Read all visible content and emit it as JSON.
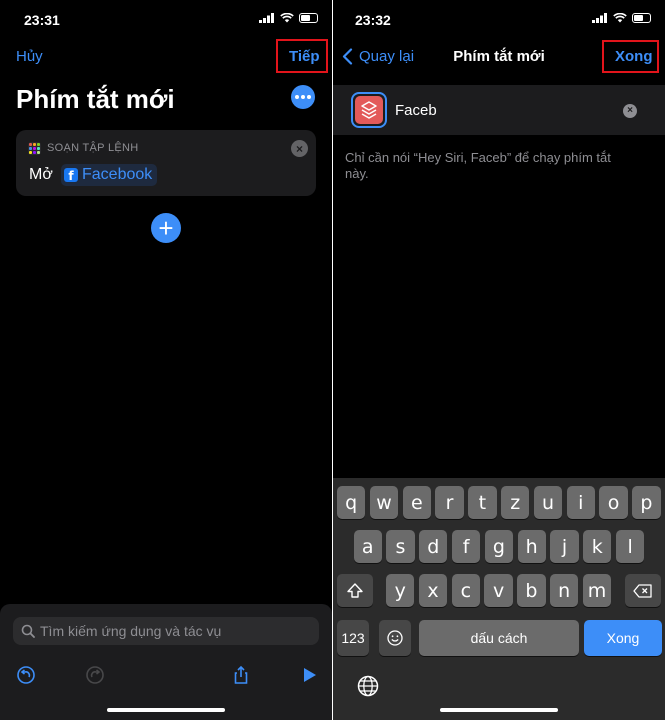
{
  "left": {
    "status": {
      "time": "23:31"
    },
    "nav": {
      "cancel": "Hủy",
      "next": "Tiếp"
    },
    "title": "Phím tắt mới",
    "action_card": {
      "header": "SOẠN TẬP LỆNH",
      "verb": "Mở",
      "app": "Facebook"
    },
    "search": {
      "placeholder": "Tìm kiếm ứng dụng và tác vụ"
    },
    "icons": [
      "undo-icon",
      "redo-icon",
      "share-icon",
      "play-icon"
    ],
    "colors": {
      "accent": "#3d8ef8",
      "highlight": "#e2141b"
    }
  },
  "right": {
    "status": {
      "time": "23:32"
    },
    "nav": {
      "back": "Quay lại",
      "title": "Phím tắt mới",
      "done": "Xong"
    },
    "name_field": {
      "value": "Faceb"
    },
    "hint": "Chỉ cần nói “Hey Siri, Faceb” để chạy phím tắt này.",
    "keyboard": {
      "row1": [
        "q",
        "w",
        "e",
        "r",
        "t",
        "z",
        "u",
        "i",
        "o",
        "p"
      ],
      "row2": [
        "a",
        "s",
        "d",
        "f",
        "g",
        "h",
        "j",
        "k",
        "l"
      ],
      "row3": [
        "y",
        "x",
        "c",
        "v",
        "b",
        "n",
        "m"
      ],
      "numbers_key": "123",
      "space_key": "dấu cách",
      "return_key": "Xong"
    }
  }
}
